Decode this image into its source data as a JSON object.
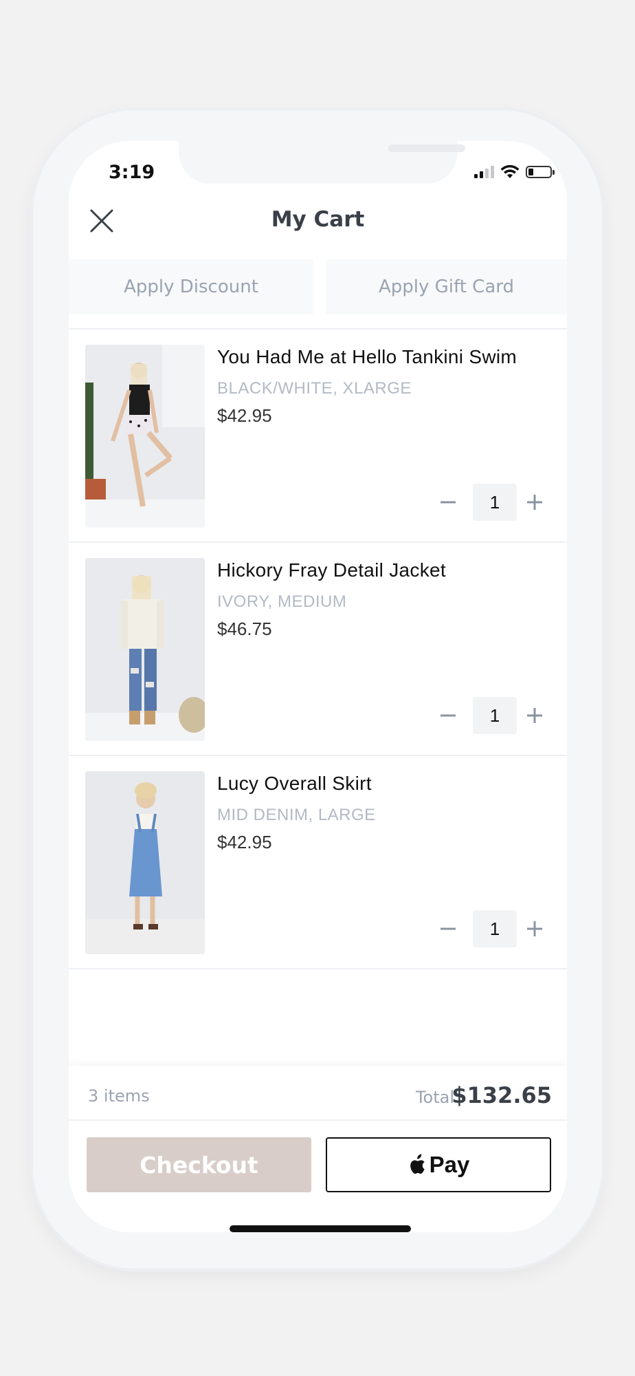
{
  "status_bar": {
    "time": "3:19",
    "icons": [
      "cellular-signal-icon",
      "wifi-icon",
      "battery-icon"
    ]
  },
  "header": {
    "title": "My Cart",
    "close_icon": "close-icon"
  },
  "actions": {
    "apply_discount": "Apply Discount",
    "apply_gift_card": "Apply Gift Card"
  },
  "cart": {
    "items": [
      {
        "name": "You Had Me at Hello Tankini Swim",
        "variant": "BLACK/WHITE, XLARGE",
        "price": "$42.95",
        "quantity": "1"
      },
      {
        "name": "Hickory Fray Detail Jacket",
        "variant": "IVORY, MEDIUM",
        "price": "$46.75",
        "quantity": "1"
      },
      {
        "name": "Lucy Overall Skirt",
        "variant": "MID DENIM, LARGE",
        "price": "$42.95",
        "quantity": "1"
      }
    ]
  },
  "footer": {
    "item_count": "3 items",
    "total_label": "Total",
    "total_value": "$132.65",
    "checkout_label": "Checkout",
    "apple_pay_label": "Pay"
  },
  "colors": {
    "checkout_bg": "#d8cdc8",
    "muted_text": "#9aa3b2",
    "title_text": "#3a4048"
  }
}
